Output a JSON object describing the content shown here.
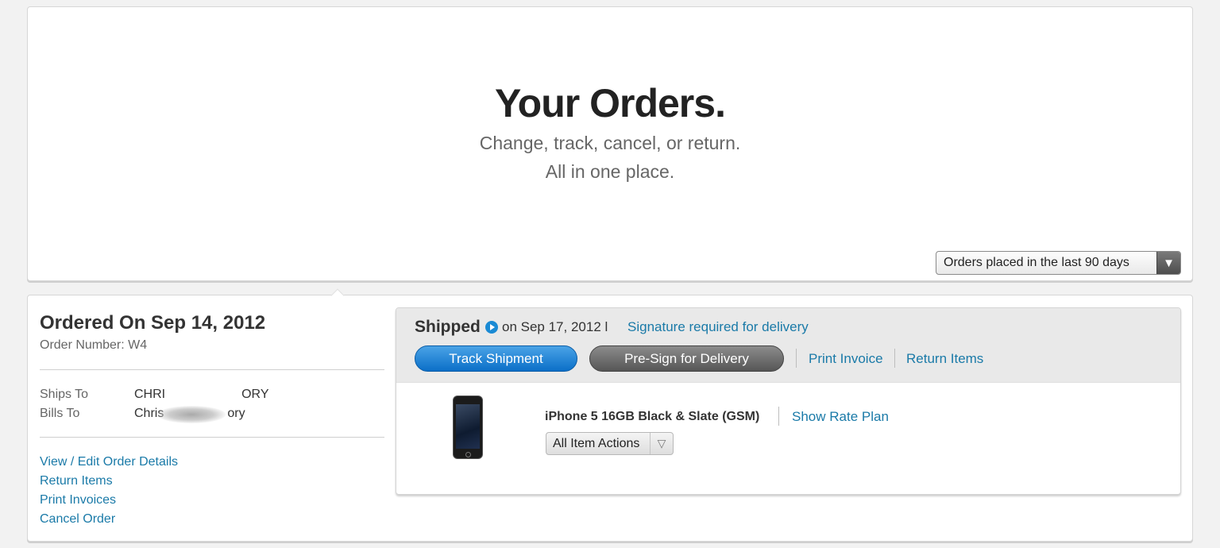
{
  "hero": {
    "title": "Your Orders.",
    "subtitle_line1": "Change, track, cancel, or return.",
    "subtitle_line2": "All in one place."
  },
  "filter": {
    "selected": "Orders placed in the last 90 days",
    "arrow_icon": "triangle-down-icon"
  },
  "order": {
    "ordered_on": "Ordered On Sep 14, 2012",
    "order_number": "Order Number: W4",
    "ships_to_label": "Ships To",
    "ships_to_value": "CHRI            ORY",
    "bills_to_label": "Bills To",
    "bills_to_value": "Chris          ory",
    "links": {
      "view_edit": "View / Edit Order Details",
      "return_items": "Return Items",
      "print_invoices": "Print Invoices",
      "cancel_order": "Cancel Order"
    }
  },
  "shipment": {
    "status": "Shipped",
    "status_icon": "play-circle-icon",
    "date": "on Sep 17, 2012 l",
    "signature_link": "Signature required for delivery",
    "track_button": "Track Shipment",
    "presign_button": "Pre-Sign for Delivery",
    "print_invoice": "Print Invoice",
    "return_items": "Return Items"
  },
  "item": {
    "name": "iPhone 5 16GB Black & Slate (GSM)",
    "rate_plan_link": "Show Rate Plan",
    "actions_label": "All Item Actions",
    "actions_arrow": "▽"
  },
  "colors": {
    "link": "#1a7aa8",
    "track_button": "#0b6fc8",
    "presign_button": "#565656",
    "background": "#f2f2f2"
  }
}
